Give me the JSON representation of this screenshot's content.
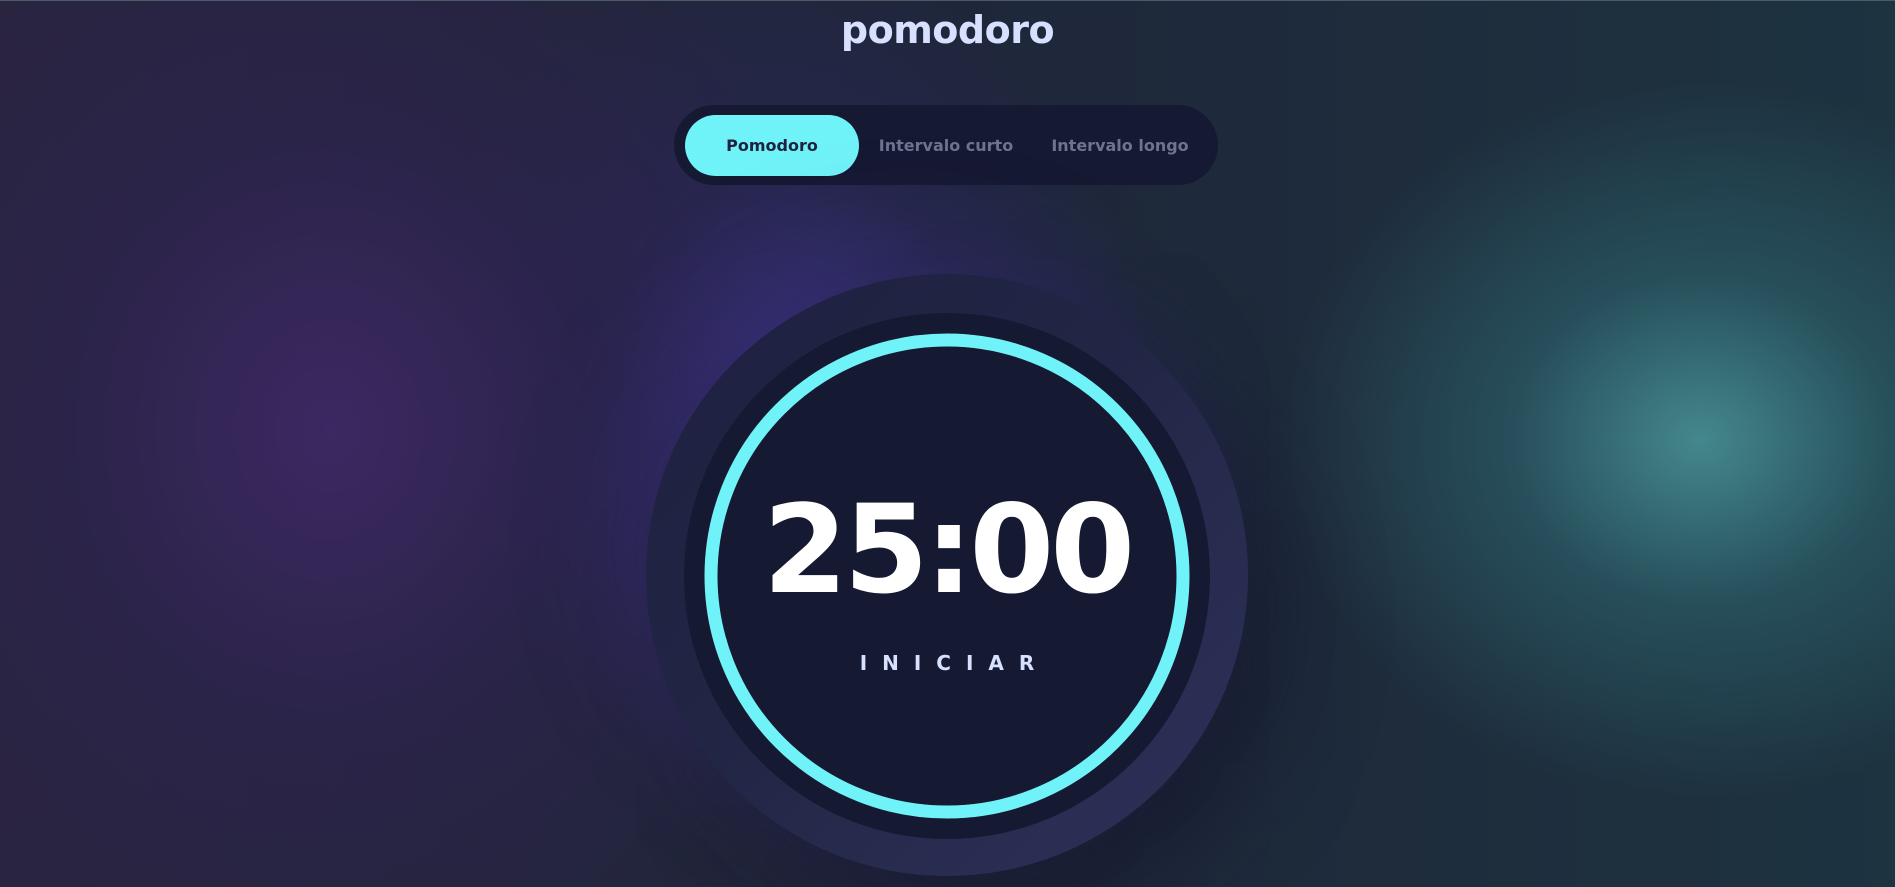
{
  "app": {
    "title": "pomodoro"
  },
  "tabs": [
    {
      "label": "Pomodoro",
      "active": true
    },
    {
      "label": "Intervalo curto",
      "active": false
    },
    {
      "label": "Intervalo longo",
      "active": false
    }
  ],
  "timer": {
    "time": "25:00",
    "action_label": "INICIAR",
    "progress": 1.0
  },
  "colors": {
    "accent": "#70f3f8",
    "title": "#d7e0fe",
    "panel": "#161932",
    "inactive_tab_text": "#6e7390"
  }
}
